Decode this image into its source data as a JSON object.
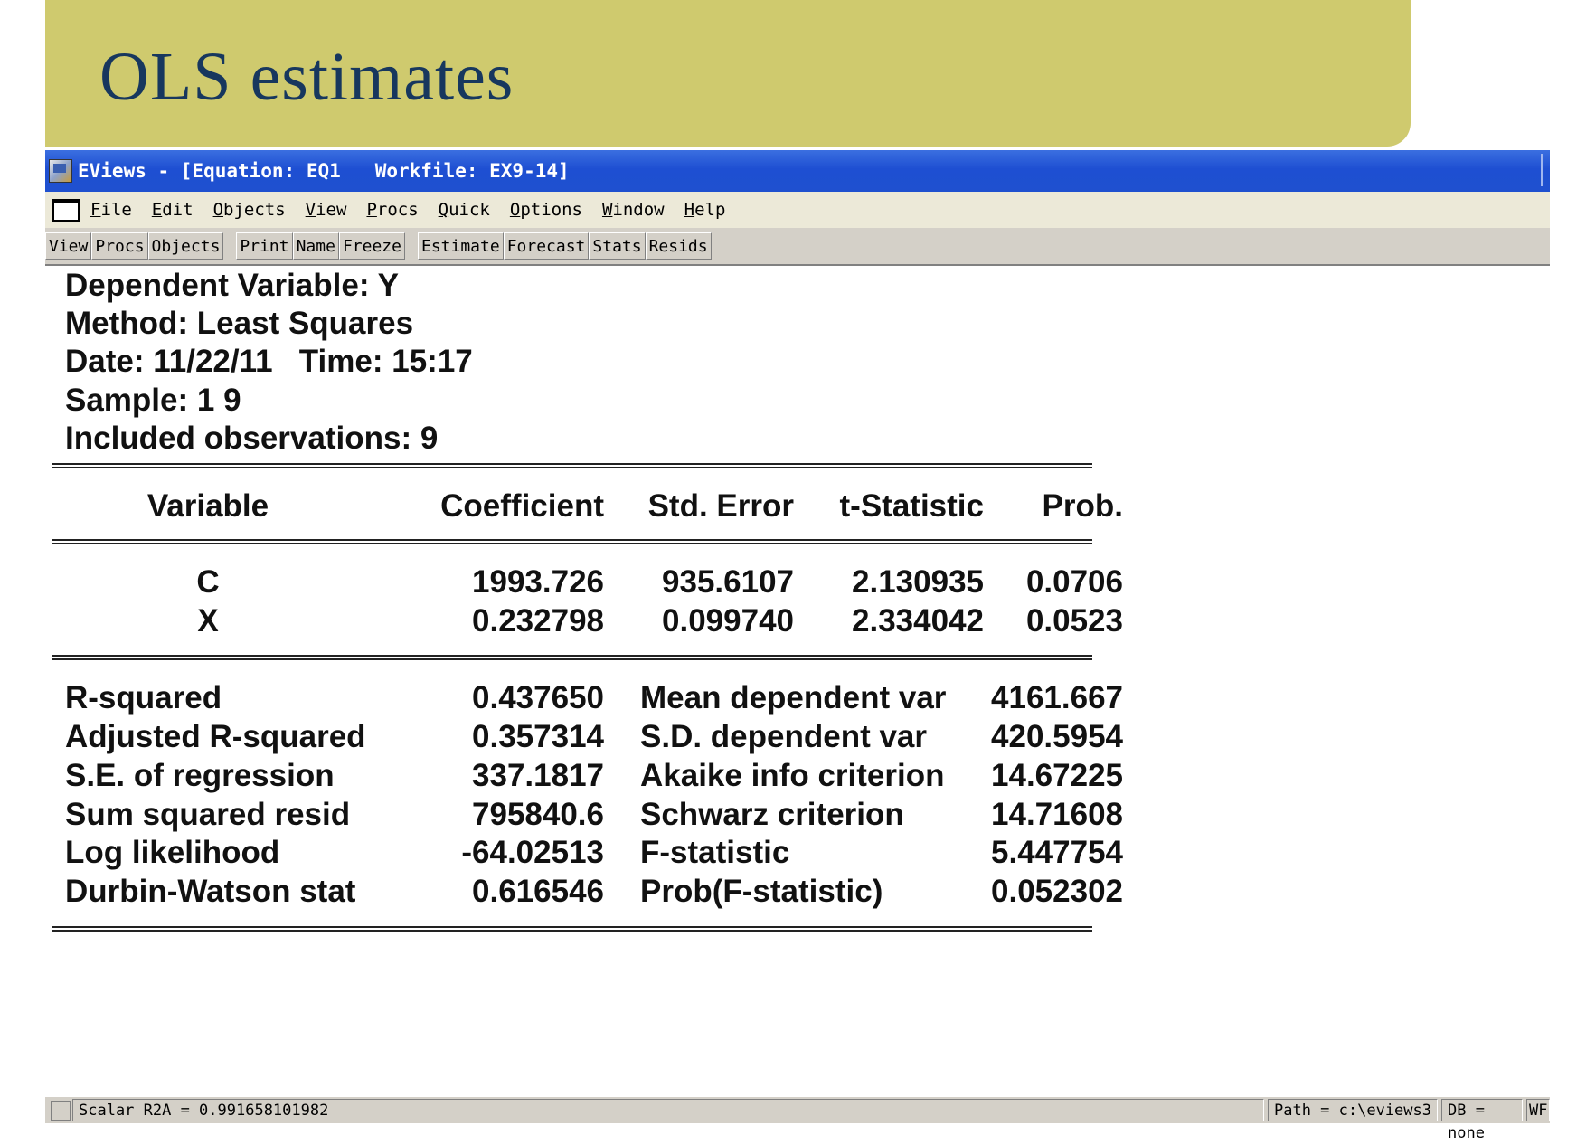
{
  "slide": {
    "title": "OLS estimates"
  },
  "window": {
    "title": "EViews - [Equation: EQ1   Workfile: EX9-14]"
  },
  "menu": [
    "File",
    "Edit",
    "Objects",
    "View",
    "Procs",
    "Quick",
    "Options",
    "Window",
    "Help"
  ],
  "toolbar": {
    "groups": [
      [
        "View",
        "Procs",
        "Objects"
      ],
      [
        "Print",
        "Name",
        "Freeze"
      ],
      [
        "Estimate",
        "Forecast",
        "Stats",
        "Resids"
      ]
    ]
  },
  "output": {
    "dependent": "Dependent Variable: Y",
    "method": "Method: Least Squares",
    "date": "Date: 11/22/11   Time: 15:17",
    "sample": "Sample: 1 9",
    "included": "Included observations: 9",
    "columns": [
      "Variable",
      "Coefficient",
      "Std. Error",
      "t-Statistic",
      "Prob."
    ],
    "coefficients": [
      {
        "variable": "C",
        "coefficient": "1993.726",
        "std_error": "935.6107",
        "t_stat": "2.130935",
        "prob": "0.0706"
      },
      {
        "variable": "X",
        "coefficient": "0.232798",
        "std_error": "0.099740",
        "t_stat": "2.334042",
        "prob": "0.0523"
      }
    ],
    "stats": [
      {
        "label": "R-squared",
        "value": "0.437650",
        "label2": "Mean dependent var",
        "value2": "4161.667"
      },
      {
        "label": "Adjusted R-squared",
        "value": "0.357314",
        "label2": "S.D. dependent var",
        "value2": "420.5954"
      },
      {
        "label": "S.E. of regression",
        "value": "337.1817",
        "label2": "Akaike info criterion",
        "value2": "14.67225"
      },
      {
        "label": "Sum squared resid",
        "value": "795840.6",
        "label2": "Schwarz criterion",
        "value2": "14.71608"
      },
      {
        "label": "Log likelihood",
        "value": "-64.02513",
        "label2": "F-statistic",
        "value2": "5.447754"
      },
      {
        "label": "Durbin-Watson stat",
        "value": "0.616546",
        "label2": "Prob(F-statistic)",
        "value2": "0.052302"
      }
    ]
  },
  "status": {
    "message": "Scalar R2A = 0.991658101982",
    "path": "Path = c:\\eviews3",
    "db": "DB = none",
    "wf": "WF"
  },
  "colors": {
    "banner": "#cfca6e",
    "title_text": "#17375e",
    "titlebar": "#1f50cf"
  }
}
